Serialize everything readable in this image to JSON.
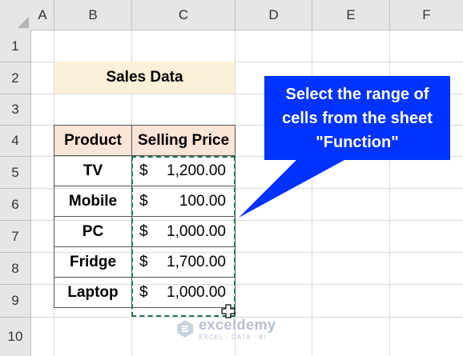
{
  "columns": [
    "A",
    "B",
    "C",
    "D",
    "E",
    "F"
  ],
  "rows": [
    "1",
    "2",
    "3",
    "4",
    "5",
    "6",
    "7",
    "8",
    "9",
    "10"
  ],
  "title": "Sales Data",
  "table": {
    "headers": [
      "Product",
      "Selling Price"
    ],
    "currency": "$",
    "rows": [
      {
        "product": "TV",
        "price": "1,200.00"
      },
      {
        "product": "Mobile",
        "price": "100.00"
      },
      {
        "product": "PC",
        "price": "1,000.00"
      },
      {
        "product": "Fridge",
        "price": "1,700.00"
      },
      {
        "product": "Laptop",
        "price": "1,000.00"
      }
    ]
  },
  "callout": {
    "line1": "Select the range of",
    "line2": "cells from the sheet",
    "line3": "\"Function\"",
    "color": "#0033ff"
  },
  "watermark": {
    "name": "exceldemy",
    "tagline": "EXCEL · DATA · BI"
  }
}
